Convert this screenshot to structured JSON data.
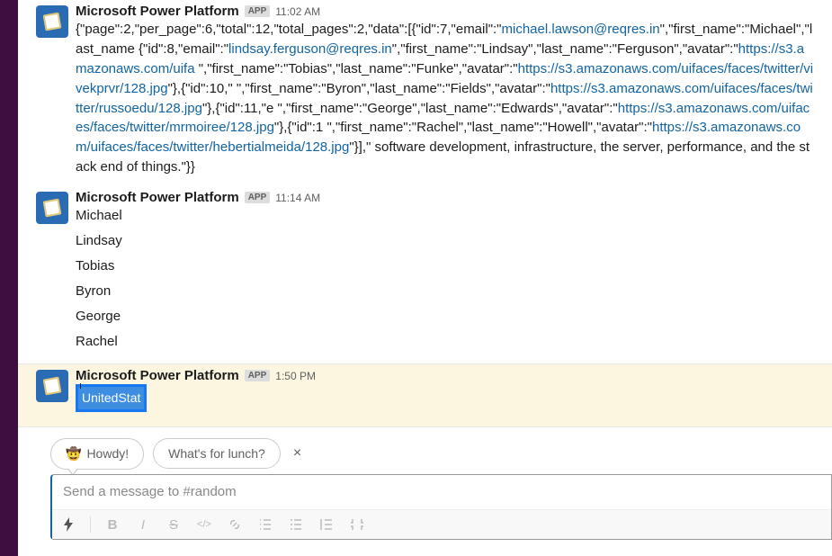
{
  "messages": [
    {
      "sender": "Microsoft Power Platform",
      "app_badge": "APP",
      "timestamp": "11:02 AM",
      "json_prefix1": "{\"page\":2,\"per_page\":6,\"total\":12,\"total_pages\":2,\"data\":[{\"id\":7,\"email\":\"",
      "link1": "michael.lawson@reqres.in",
      "json_mid1": "\",\"first_name\":\"Michael\",\"last_name",
      "json_prefix2": "{\"id\":8,\"email\":\"",
      "link2": "lindsay.ferguson@reqres.in",
      "json_mid2": "\",\"first_name\":\"Lindsay\",\"last_name\":\"Ferguson\",\"avatar\":\"",
      "link3": "https://s3.amazonaws.com/uifa",
      "json_prefix3": "\",\"first_name\":\"Tobias\",\"last_name\":\"Funke\",\"avatar\":\"",
      "link4": "https://s3.amazonaws.com/uifaces/faces/twitter/vivekprvr/128.jpg",
      "json_mid3": "\"},{\"id\":10,\"",
      "json_prefix4": "\",\"first_name\":\"Byron\",\"last_name\":\"Fields\",\"avatar\":\"",
      "link5": "https://s3.amazonaws.com/uifaces/faces/twitter/russoedu/128.jpg",
      "json_mid4": "\"},{\"id\":11,\"e",
      "json_prefix5": "\",\"first_name\":\"George\",\"last_name\":\"Edwards\",\"avatar\":\"",
      "link6": "https://s3.amazonaws.com/uifaces/faces/twitter/mrmoiree/128.jpg",
      "json_mid5": "\"},{\"id\":1",
      "json_prefix6": "\",\"first_name\":\"Rachel\",\"last_name\":\"Howell\",\"avatar\":\"",
      "link7": "https://s3.amazonaws.com/uifaces/faces/twitter/hebertialmeida/128.jpg",
      "json_mid6": "\"}],\"",
      "json_tail": "software development, infrastructure, the server, performance, and the stack end of things.\"}}"
    },
    {
      "sender": "Microsoft Power Platform",
      "app_badge": "APP",
      "timestamp": "11:14 AM",
      "names": [
        "Michael",
        "Lindsay",
        "Tobias",
        "Byron",
        "George",
        "Rachel"
      ]
    },
    {
      "sender": "Microsoft Power Platform",
      "app_badge": "APP",
      "timestamp": "1:50 PM",
      "highlighted_text": "UnitedStat"
    }
  ],
  "suggestions": {
    "howdy_emoji": "🤠",
    "howdy_label": "Howdy!",
    "lunch_label": "What's for lunch?",
    "close": "×"
  },
  "compose": {
    "placeholder": "Send a message to #random"
  },
  "toolbar": {
    "bolt": "⚡",
    "bold": "B",
    "italic": "I",
    "strike": "S",
    "code": "</>",
    "link": "🔗"
  }
}
